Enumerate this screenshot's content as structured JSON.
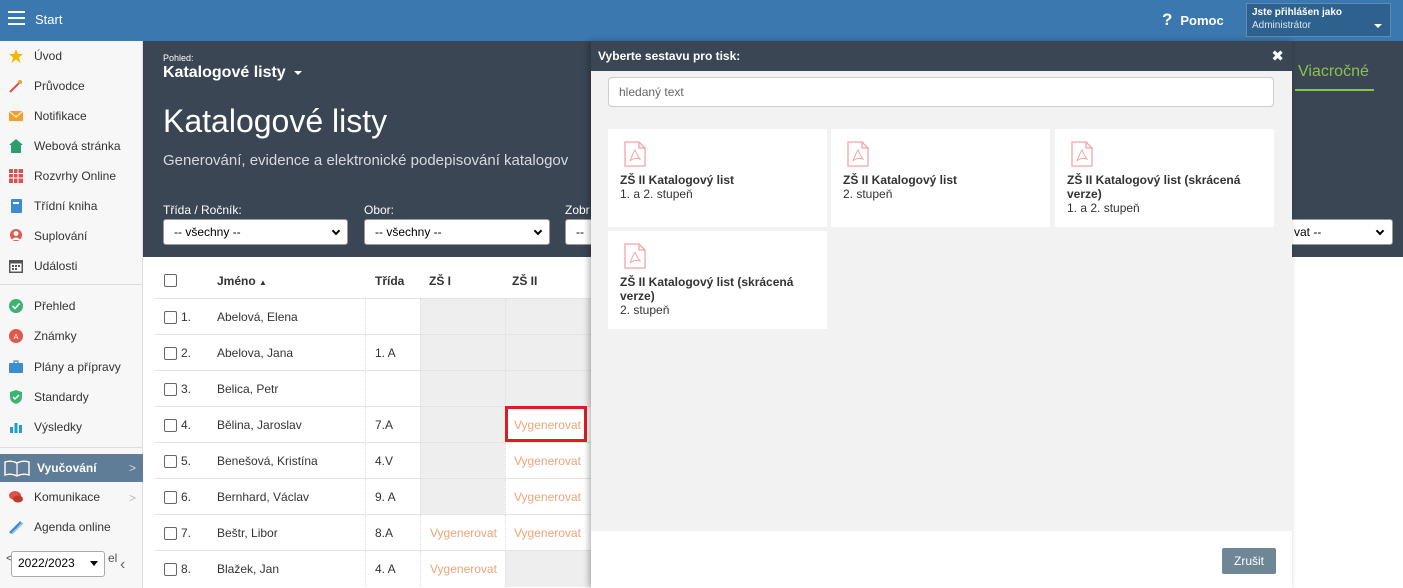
{
  "topbar": {
    "start_label": "Start",
    "help_label": "Pomoc",
    "user_line1": "Jste přihlášen jako",
    "user_line2": "Administrátor"
  },
  "sidebar": {
    "items": [
      {
        "label": "Úvod",
        "icon": "star-icon"
      },
      {
        "label": "Průvodce",
        "icon": "wand-icon"
      },
      {
        "label": "Notifikace",
        "icon": "envelope-icon"
      },
      {
        "label": "Webová stránka",
        "icon": "home-icon"
      },
      {
        "label": "Rozvrhy Online",
        "icon": "timetable-icon"
      },
      {
        "label": "Třídní kniha",
        "icon": "book-icon"
      },
      {
        "label": "Suplování",
        "icon": "person-icon"
      },
      {
        "label": "Události",
        "icon": "calendar-icon"
      },
      {
        "label": "Přehled",
        "icon": "check-circle-icon"
      },
      {
        "label": "Známky",
        "icon": "grade-icon"
      },
      {
        "label": "Plány a přípravy",
        "icon": "briefcase-icon"
      },
      {
        "label": "Standardy",
        "icon": "shield-check-icon"
      },
      {
        "label": "Výsledky",
        "icon": "bar-chart-icon"
      },
      {
        "label": "Vyučování",
        "icon": "open-book-icon"
      },
      {
        "label": "Komunikace",
        "icon": "chat-icon"
      },
      {
        "label": "Agenda online",
        "icon": "pen-icon"
      }
    ],
    "partial_label": "el",
    "year": "2022/2023"
  },
  "header": {
    "pohled_label": "Pohled:",
    "pohled_value": "Katalogové listy",
    "title": "Katalogové listy",
    "subtitle": "Generování, evidence a elektronické podepisování katalogov",
    "filters": [
      {
        "label": "Třída / Ročník:",
        "value": "-- všechny --"
      },
      {
        "label": "Obor:",
        "value": "-- všechny --"
      },
      {
        "label": "Zobr",
        "value": "--"
      }
    ],
    "right_tab": "Viacročné",
    "right_select": "vat --"
  },
  "table": {
    "columns": [
      "Jméno",
      "Třída",
      "ZŠ I",
      "ZŠ II"
    ],
    "rows": [
      {
        "num": "1.",
        "name": "Abelová, Elena",
        "class": "",
        "zs1": "",
        "zs2": ""
      },
      {
        "num": "2.",
        "name": "Abelova, Jana",
        "class": "1. A",
        "zs1": "",
        "zs2": ""
      },
      {
        "num": "3.",
        "name": "Belica, Petr",
        "class": "",
        "zs1": "",
        "zs2": ""
      },
      {
        "num": "4.",
        "name": "Bělina, Jaroslav",
        "class": "7.A",
        "zs1": "",
        "zs2": "Vygenerovat"
      },
      {
        "num": "5.",
        "name": "Benešová, Kristína",
        "class": "4.V",
        "zs1": "",
        "zs2": "Vygenerovat"
      },
      {
        "num": "6.",
        "name": "Bernhard, Václav",
        "class": "9. A",
        "zs1": "",
        "zs2": "Vygenerovat"
      },
      {
        "num": "7.",
        "name": "Beštr, Libor",
        "class": "8.A",
        "zs1": "Vygenerovat",
        "zs2": "Vygenerovat"
      },
      {
        "num": "8.",
        "name": "Blažek, Jan",
        "class": "4. A",
        "zs1": "Vygenerovat",
        "zs2": ""
      }
    ]
  },
  "modal": {
    "title": "Vyberte sestavu pro tisk:",
    "search_placeholder": "hledaný text",
    "cards": [
      {
        "title": "ZŠ II Katalogový list",
        "subtitle": "1. a 2. stupeň"
      },
      {
        "title": "ZŠ II Katalogový list",
        "subtitle": "2. stupeň"
      },
      {
        "title": "ZŠ II Katalogový list (skrácená verze)",
        "subtitle": "1. a 2. stupeň"
      },
      {
        "title": "ZŠ II Katalogový list (skrácená verze)",
        "subtitle": "2. stupeň"
      }
    ],
    "cancel_label": "Zrušit"
  }
}
